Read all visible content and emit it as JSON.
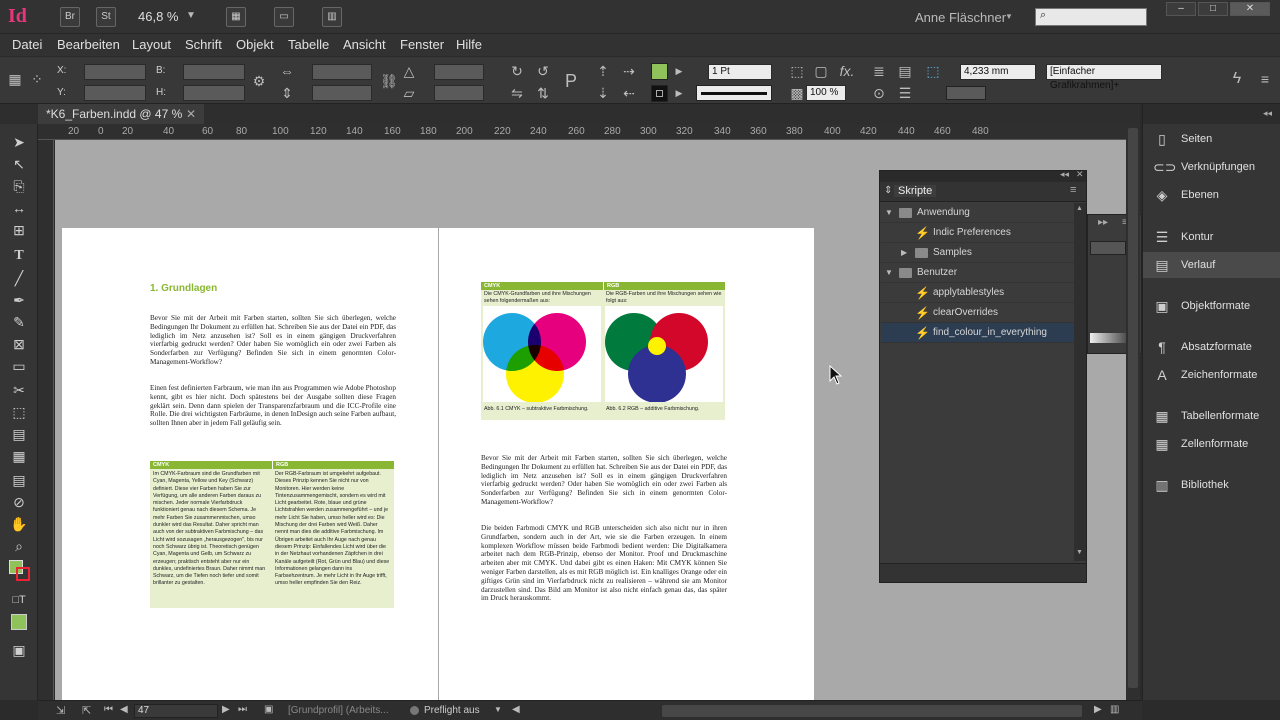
{
  "app": {
    "logo": "Id",
    "bridge_btn": "Br",
    "stock_btn": "St",
    "zoom": "46,8 %",
    "user": "Anne Fläschner"
  },
  "menu": [
    "Datei",
    "Bearbeiten",
    "Layout",
    "Schrift",
    "Objekt",
    "Tabelle",
    "Ansicht",
    "Fenster",
    "Hilfe"
  ],
  "control": {
    "x_label": "X:",
    "y_label": "Y:",
    "b_label": "B:",
    "h_label": "H:",
    "stroke_weight": "1 Pt",
    "opacity": "100 %",
    "size_mm": "4,233 mm",
    "frame_style": "[Einfacher Grafikrahmen]+",
    "fill_color": "#8fc25a"
  },
  "document": {
    "tab": "*K6_Farben.indd @ 47 %"
  },
  "ruler": [
    "20",
    "0",
    "20",
    "40",
    "60",
    "80",
    "100",
    "120",
    "140",
    "160",
    "180",
    "200",
    "220",
    "240",
    "260",
    "280",
    "300",
    "320",
    "340",
    "360",
    "380",
    "400",
    "420",
    "440",
    "460",
    "480"
  ],
  "page_left": {
    "heading": "1.  Grundlagen",
    "para1": "Bevor Sie mit der Arbeit mit Farben starten, sollten Sie sich überlegen, welche Bedingungen Ihr Dokument zu erfüllen hat. Schreiben Sie aus der Datei ein PDF, das lediglich im Netz anzusehen ist? Soll es in einem gängigen Druckverfahren vierfarbig gedruckt werden? Oder haben Sie womöglich ein oder zwei Farben als Sonderfarben zur Verfügung? Befinden Sie sich in einem genormten Color-Management-Workflow?",
    "para2": "Einen fest definierten Farbraum, wie man ihn aus Programmen wie Adobe Photoshop kennt, gibt es hier nicht. Doch spätestens bei der Ausgabe sollten diese Fragen geklärt sein. Denn dann spielen der Transparenzfarbraum und die ICC-Profile eine Rolle. Die drei wichtigsten Farbräume, in denen InDesign auch seine Farben aufbaut, sollten Ihnen aber in jedem Fall geläufig sein.",
    "table_col1_head": "CMYK",
    "table_col2_head": "RGB",
    "table_col1": "Im CMYK-Farbraum sind die Grundfarben mit Cyan, Magenta, Yellow und Key (Schwarz) definiert. Diese vier Farben haben Sie zur Verfügung, um alle anderen Farben daraus zu mischen. Jeder normale Vierfarbdruck funktioniert genau nach diesem Schema. Je mehr Farben Sie zusammenmischen, umso dunkler wird das Resultat. Daher spricht man auch von der subtraktiven Farbmischung – das Licht wird sozusagen „herausgezogen\", bis nur noch Schwarz übrig ist. Theoretisch genügen Cyan, Magenta und Gelb, um Schwarz zu erzeugen; praktisch entsteht aber nur ein dunkles, undefiniertes Braun. Daher nimmt man Schwarz, um die Tiefen noch tiefer und somit brillanter zu gestalten.",
    "table_col2": "Der RGB-Farbraum ist umgekehrt aufgebaut. Dieses Prinzip kennen Sie nicht nur von Monitoren. Hier werden keine Tintenzusammengemischt, sondern es wird mit Licht gearbeitet. Rote, blaue und grüne Lichtstrahlen werden zusammengeführt – und je mehr Licht Sie haben, umso heller wird es: Die Mischung der drei Farben wird Weiß. Daher nennt man dies die additive Farbmischung. Im Übrigen arbeitet auch Ihr Auge nach genau diesem Prinzip: Einfallendes Licht wird über die in der Netzhaut vorhandenen Zäpfchen in drei Kanäle aufgeteilt (Rot, Grün und Blau) und diese Informationen gelangen dann ins Farbsehzentrum. Je mehr Licht in Ihr Auge trifft, umso heller empfinden Sie den Reiz."
  },
  "page_right": {
    "fig_cmyk_head": "CMYK",
    "fig_rgb_head": "RGB",
    "fig_cmyk_sub": "Die CMYK-Grundfarben und ihre Mischungen sehen folgendermaßen aus:",
    "fig_rgb_sub": "Die RGB-Farben und ihre Mischungen sehen wie folgt aus:",
    "fig_cmyk_caption": "Abb. 6.1  CMYK – subtraktive Farbmischung.",
    "fig_rgb_caption": "Abb. 6.2  RGB – additive Farbmischung.",
    "para1": "Bevor Sie mit der Arbeit mit Farben starten, sollten Sie sich überlegen, welche Bedingungen Ihr Dokument zu erfüllen hat. Schreiben Sie aus der Datei ein PDF, das lediglich im Netz anzusehen ist? Soll es in einem gängigen Druckverfahren vierfarbig gedruckt werden? Oder haben Sie womöglich ein oder zwei Farben als Sonderfarben zur Verfügung? Befinden Sie sich in einem genormten Color-Management-Workflow?",
    "para2": "Die beiden Farbmodi CMYK und RGB unterscheiden sich also nicht nur in ihren Grundfarben, sondern auch in der Art, wie sie die Farben erzeugen. In einem komplexen Workflow müssen beide Farbmodi bedient werden: Die Digitalkamera arbeitet nach dem RGB-Prinzip, ebenso der Monitor. Proof und Druckmaschine arbeiten aber mit CMYK. Und dabei gibt es einen Haken: Mit CMYK können Sie weniger Farben darstellen, als es mit RGB möglich ist. Ein knalliges Orange oder ein giftiges Grün sind im Vierfarbdruck nicht zu realisieren – während sie am Monitor darzustellen sind. Das Bild am Monitor ist also nicht einfach genau das, das später im Druck herauskommt."
  },
  "scripts_panel": {
    "title": "Skripte",
    "rows": [
      {
        "label": "Anwendung",
        "kind": "folder",
        "level": 0,
        "expanded": true
      },
      {
        "label": "Indic Preferences",
        "kind": "script",
        "level": 1
      },
      {
        "label": "Samples",
        "kind": "folder",
        "level": 1,
        "expanded": false
      },
      {
        "label": "Benutzer",
        "kind": "folder",
        "level": 0,
        "expanded": true
      },
      {
        "label": "applytablestyles",
        "kind": "script",
        "level": 1
      },
      {
        "label": "clearOverrides",
        "kind": "script",
        "level": 1
      },
      {
        "label": "find_colour_in_everything",
        "kind": "script",
        "level": 1,
        "selected": true
      }
    ]
  },
  "dock": [
    {
      "label": "Seiten",
      "icon": "pages-icon",
      "glyph": "▯"
    },
    {
      "label": "Verknüpfungen",
      "icon": "links-icon",
      "glyph": "⊂⊃"
    },
    {
      "label": "Ebenen",
      "icon": "layers-icon",
      "glyph": "◈"
    },
    {
      "label": "Kontur",
      "icon": "stroke-icon",
      "glyph": "☰"
    },
    {
      "label": "Verlauf",
      "icon": "gradient-icon",
      "glyph": "▤",
      "active": true
    },
    {
      "label": "Objektformate",
      "icon": "object-styles-icon",
      "glyph": "▣"
    },
    {
      "label": "Absatzformate",
      "icon": "paragraph-styles-icon",
      "glyph": "¶"
    },
    {
      "label": "Zeichenformate",
      "icon": "character-styles-icon",
      "glyph": "A"
    },
    {
      "label": "Tabellenformate",
      "icon": "table-styles-icon",
      "glyph": "▦"
    },
    {
      "label": "Zellenformate",
      "icon": "cell-styles-icon",
      "glyph": "▦"
    },
    {
      "label": "Bibliothek",
      "icon": "library-icon",
      "glyph": "▥"
    }
  ],
  "status": {
    "page": "47",
    "profile": "[Grundprofil] (Arbeits...",
    "preflight": "Preflight aus"
  }
}
